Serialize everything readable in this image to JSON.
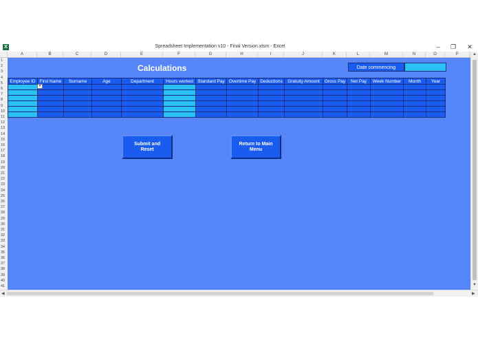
{
  "window": {
    "title": "Spreadsheet Implementation v10 - Final Version.xlsm - Excel",
    "app_icon_letter": "X",
    "minimize": "–",
    "restore": "❐",
    "close": "✕"
  },
  "columns": [
    "A",
    "B",
    "C",
    "D",
    "E",
    "F",
    "G",
    "H",
    "I",
    "J",
    "K",
    "L",
    "M",
    "N",
    "O",
    "P"
  ],
  "rows": [
    "1",
    "2",
    "3",
    "4",
    "5",
    "6",
    "7",
    "8",
    "9",
    "10",
    "11",
    "12",
    "13",
    "14",
    "15",
    "16",
    "17",
    "18",
    "19",
    "20",
    "21",
    "22",
    "23",
    "24",
    "25",
    "26",
    "27",
    "28",
    "29",
    "30",
    "31",
    "32",
    "33",
    "34",
    "35",
    "36",
    "37",
    "38",
    "39",
    "40",
    "41"
  ],
  "sheet": {
    "heading": "Calculations",
    "date_label": "Date commencing",
    "date_value": "",
    "table_headers": [
      "Employee ID",
      "First Name",
      "Surname",
      "Age",
      "Department",
      "Hours worked",
      "Standard Pay",
      "Overtime Pay",
      "Deductions",
      "Gratuity Amount",
      "Gross Pay",
      "Net Pay",
      "Week Number",
      "Month",
      "Year"
    ],
    "dropdown_glyph": "▾",
    "submit_button": "Submit and Reset",
    "return_button": "Return to Main Menu"
  },
  "colors": {
    "sheet_bg": "#5585f7",
    "cell_blue": "#1a5cf0",
    "highlight_cyan": "#28c0f5"
  }
}
